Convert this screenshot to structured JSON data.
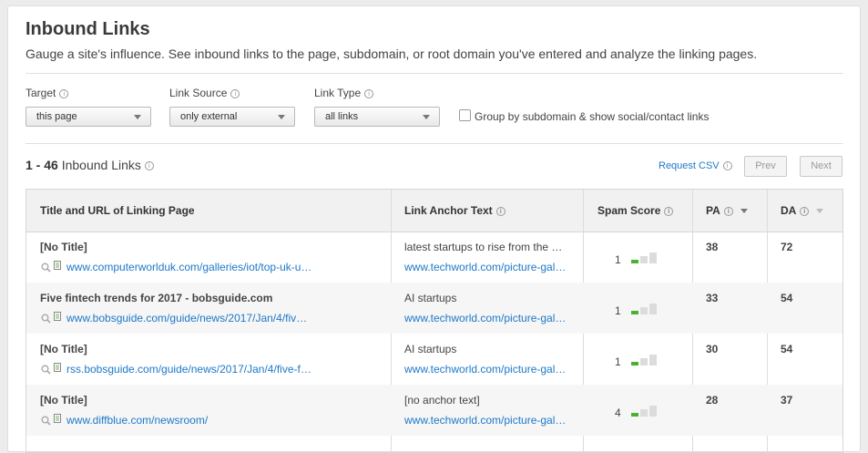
{
  "header": {
    "title": "Inbound Links",
    "subtitle": "Gauge a site's influence. See inbound links to the page, subdomain, or root domain you've entered and analyze the linking pages."
  },
  "filters": {
    "target": {
      "label": "Target",
      "value": "this page"
    },
    "link_source": {
      "label": "Link Source",
      "value": "only external"
    },
    "link_type": {
      "label": "Link Type",
      "value": "all links"
    },
    "group_label": "Group by subdomain & show social/contact links",
    "group_checked": false
  },
  "results": {
    "range": "1 - 46",
    "label": "Inbound Links",
    "request_csv": "Request CSV",
    "prev": "Prev",
    "next": "Next"
  },
  "table": {
    "columns": {
      "title_url": "Title and URL of Linking Page",
      "anchor": "Link Anchor Text",
      "spam": "Spam Score",
      "pa": "PA",
      "da": "DA"
    },
    "rows": [
      {
        "title": "[No Title]",
        "url": "www.computerworlduk.com/galleries/iot/top-uk-u…",
        "anchor": "latest startups to rise from the …",
        "anchor_url": "www.techworld.com/picture-gal…",
        "spam": "1",
        "pa": "38",
        "da": "72"
      },
      {
        "title": "Five fintech trends for 2017 - bobsguide.com",
        "url": "www.bobsguide.com/guide/news/2017/Jan/4/fiv…",
        "anchor": "AI startups",
        "anchor_url": "www.techworld.com/picture-gal…",
        "spam": "1",
        "pa": "33",
        "da": "54"
      },
      {
        "title": "[No Title]",
        "url": "rss.bobsguide.com/guide/news/2017/Jan/4/five-f…",
        "anchor": "AI startups",
        "anchor_url": "www.techworld.com/picture-gal…",
        "spam": "1",
        "pa": "30",
        "da": "54"
      },
      {
        "title": "[No Title]",
        "url": "www.diffblue.com/newsroom/",
        "anchor": "[no anchor text]",
        "anchor_url": "www.techworld.com/picture-gal…",
        "spam": "4",
        "pa": "28",
        "da": "37"
      }
    ]
  },
  "colors": {
    "link": "#1e78c8",
    "spam_low": "#4caf30",
    "bar_empty": "#dcdcdc"
  }
}
